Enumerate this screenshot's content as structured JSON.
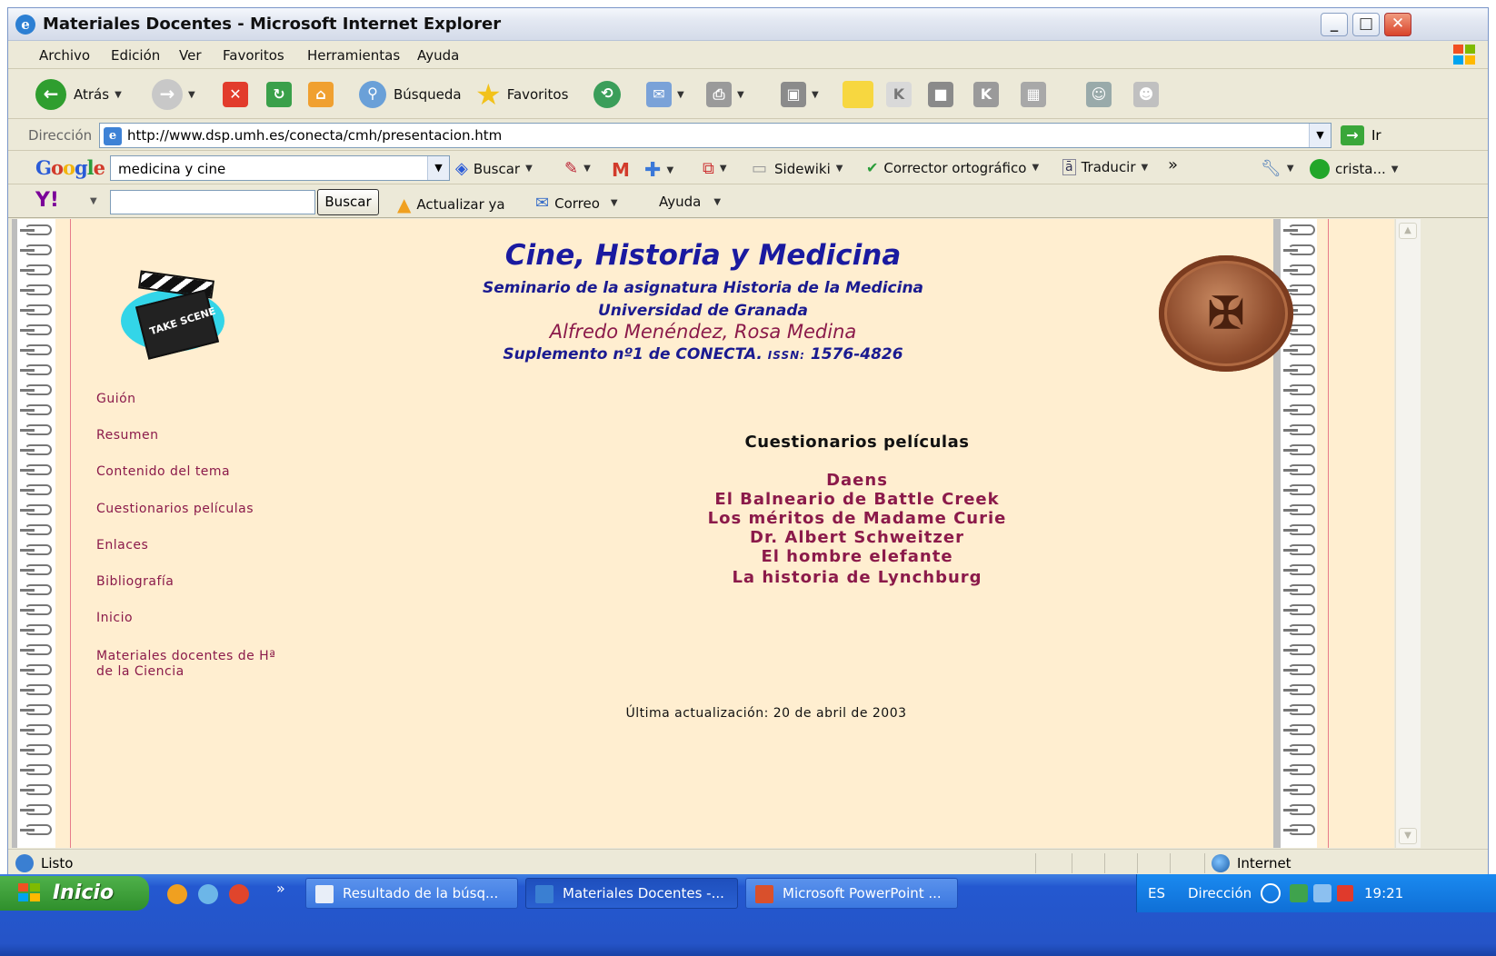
{
  "window": {
    "title": "Materiales Docentes - Microsoft Internet Explorer",
    "buttons": {
      "minimize": "_",
      "maximize": "□",
      "close": "✕"
    }
  },
  "menu": [
    "Archivo",
    "Edición",
    "Ver",
    "Favoritos",
    "Herramientas",
    "Ayuda"
  ],
  "toolbar": {
    "back_label": "Atrás",
    "search_label": "Búsqueda",
    "favorites_label": "Favoritos"
  },
  "address": {
    "label": "Dirección",
    "url": "http://www.dsp.umh.es/conecta/cmh/presentacion.htm",
    "go_label": "Ir"
  },
  "google_bar": {
    "logo": "Google",
    "query": "medicina y cine",
    "search_label": "Buscar",
    "sidewiki": "Sidewiki",
    "spellcheck": "Corrector ortográfico",
    "translate": "Traducir",
    "more": "»",
    "user": "crista..."
  },
  "yahoo_bar": {
    "logo": "Y!",
    "search_value": "",
    "search_button": "Buscar",
    "update": "Actualizar ya",
    "mail": "Correo",
    "help": "Ayuda"
  },
  "page": {
    "title": "Cine, Historia y Medicina",
    "subtitle": "Seminario de la asignatura Historia de la Medicina",
    "university": "Universidad de Granada",
    "authors": "Alfredo Menéndez, Rosa Medina",
    "supplement": "Suplemento nº1 de CONECTA.",
    "issn_label": "ISSN:",
    "issn_value": "1576-4826",
    "clapper_text": "TAKE  SCENE",
    "nav": [
      "Guión",
      "Resumen",
      "Contenido del tema",
      "Cuestionarios películas",
      "Enlaces",
      "Bibliografía",
      "Inicio",
      "Materiales docentes de Hª",
      "de la Ciencia"
    ],
    "section_title": "Cuestionarios películas",
    "films": [
      "Daens",
      "El Balneario de Battle Creek",
      "Los méritos de Madame Curie",
      "Dr. Albert Schweitzer",
      "El hombre elefante",
      "La historia de Lynchburg"
    ],
    "updated": "Última actualización: 20 de abril de 2003"
  },
  "status": {
    "text": "Listo",
    "zone": "Internet"
  },
  "taskbar": {
    "start": "Inicio",
    "quicklaunch_more": "»",
    "tasks": [
      "Resultado de la búsq...",
      "Materiales Docentes -...",
      "Microsoft PowerPoint ..."
    ],
    "lang": "ES",
    "address_label": "Dirección",
    "clock": "19:21"
  },
  "colors": {
    "page_bg": "#ffeed0",
    "title_blue": "#1a1aa0",
    "link_maroon": "#8b1a4a",
    "taskbar_blue": "#2554c7"
  }
}
